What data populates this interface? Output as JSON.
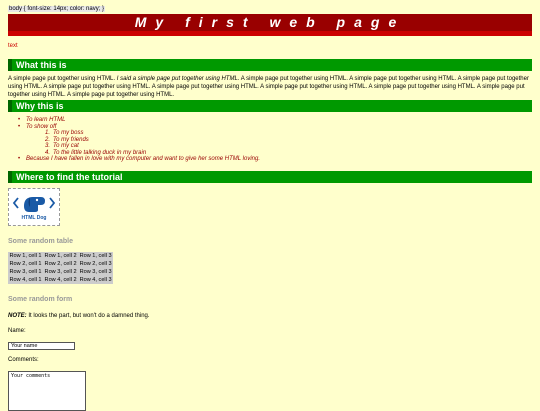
{
  "css_snippet": "body { font-size: 14px; color: navy; }",
  "page_title": "My first web page",
  "red_text": "text",
  "sections": {
    "what": "What this is",
    "why": "Why this is",
    "where": "Where to find the tutorial"
  },
  "paragraph": {
    "part1": "A simple page put together using HTML. ",
    "emphasis": "I said a simple page put together using HTML.",
    "part2": " A simple page put together using HTML. A simple page put together using HTML. A simple page put together using HTML. A simple page put together using HTML. A simple page put together using HTML. A simple page put together using HTML. A simple page put together using HTML. A simple page put together using HTML. A simple page put together using HTML."
  },
  "why_list": {
    "item1": "To learn HTML",
    "item2": "To show off",
    "sub1": "To my boss",
    "sub2": "To my friends",
    "sub3": "To my cat",
    "sub4": "To the little talking duck in my brain",
    "item3": "Because I have fallen in love with my computer and want to give her some HTML loving."
  },
  "logo_text": "HTML Dog",
  "table_heading": "Some random table",
  "table_rows": [
    [
      "Row 1, cell 1",
      "Row 1, cell 2",
      "Row 1, cell 3"
    ],
    [
      "Row 2, cell 1",
      "Row 2, cell 2",
      "Row 2, cell 3"
    ],
    [
      "Row 3, cell 1",
      "Row 3, cell 2",
      "Row 3, cell 3"
    ],
    [
      "Row 4, cell 1",
      "Row 4, cell 2",
      "Row 4, cell 3"
    ]
  ],
  "form_heading": "Some random form",
  "note_label": "NOTE:",
  "note_text": " It looks the part, but won't do a damned thing.",
  "name_label": "Name:",
  "name_value": "Your name",
  "comments_label": "Comments:",
  "comments_value": "Your comments",
  "colors": {
    "background": "#ffffcc",
    "banner": "#990000",
    "section": "#009900"
  }
}
